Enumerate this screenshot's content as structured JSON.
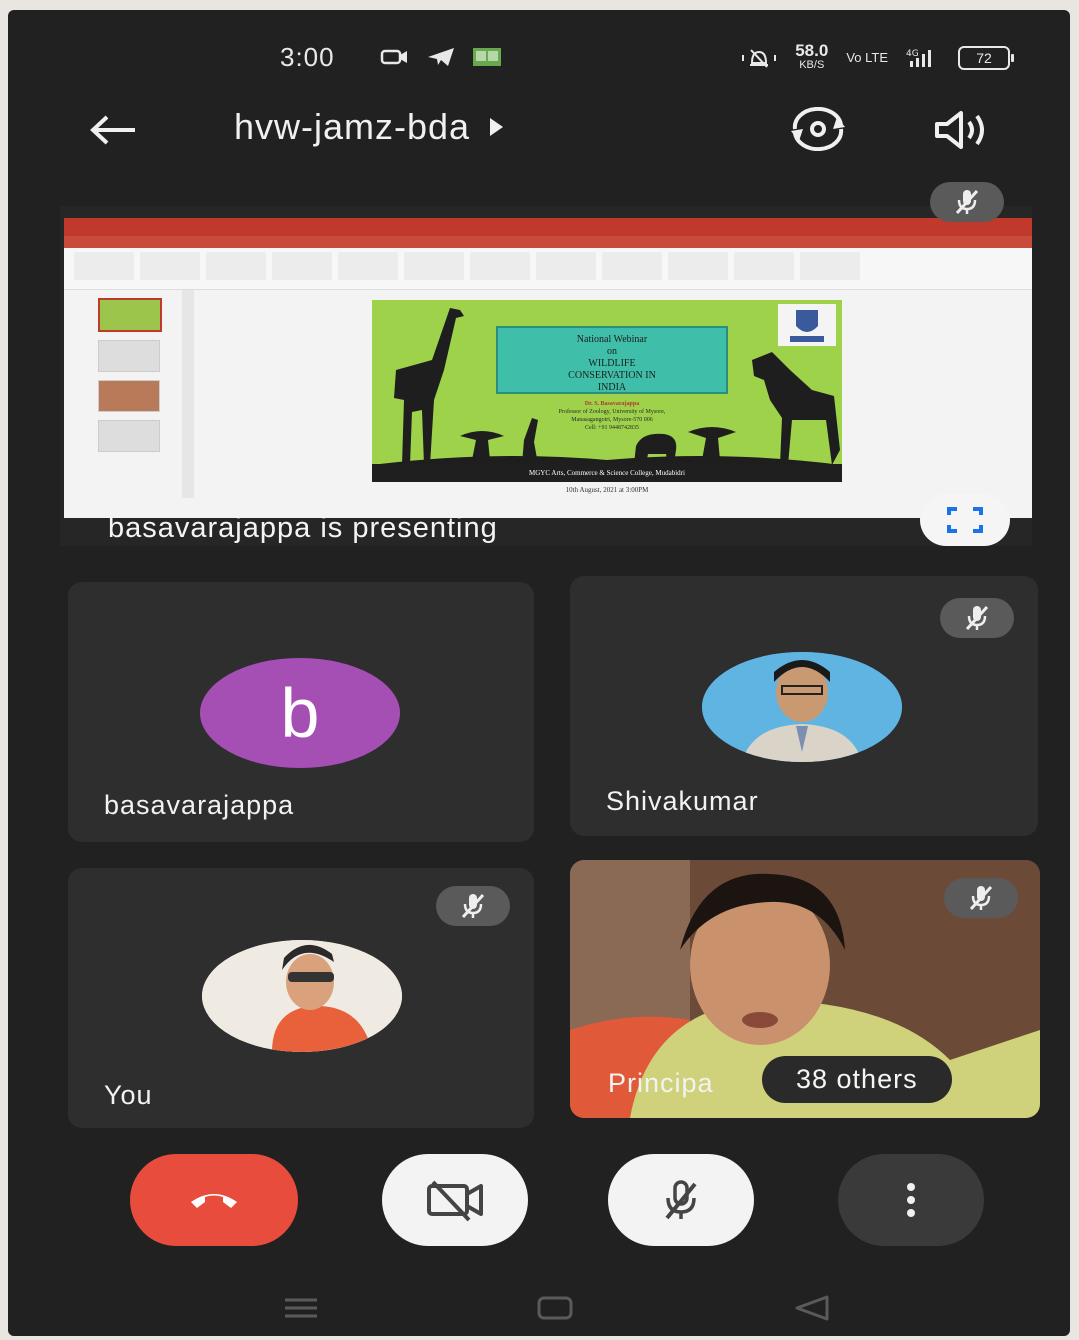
{
  "status_bar": {
    "time": "3:00",
    "speed_value": "58.0",
    "speed_unit": "KB/S",
    "network": "Vo LTE",
    "network_type": "4G",
    "battery": "72"
  },
  "header": {
    "meeting_code": "hvw-jamz-bda"
  },
  "presentation": {
    "caption": "basavarajappa is presenting",
    "slide": {
      "heading_lines": [
        "National Webinar",
        "on",
        "WILDLIFE",
        "CONSERVATION IN",
        "INDIA"
      ],
      "speaker": "Dr. S. Basavarajappa",
      "affiliation": "Professor of Zoology, University of Mysore,",
      "address": "Manasagangotri, Mysore-570 006",
      "cell": "Cell: +91 9448742835",
      "college": "MGYC Arts, Commerce & Science College, Mudabidri",
      "date": "10th August, 2021 at 3:00PM"
    }
  },
  "participants": [
    {
      "name": "basavarajappa",
      "initial": "b",
      "muted": false
    },
    {
      "name": "Shivakumar",
      "muted": true
    },
    {
      "name": "You",
      "muted": true
    },
    {
      "name": "Principa",
      "muted": true
    }
  ],
  "others_label": "38 others",
  "colors": {
    "end_call": "#e74c3c",
    "avatar_purple": "#a54fb4",
    "background": "#212121"
  }
}
